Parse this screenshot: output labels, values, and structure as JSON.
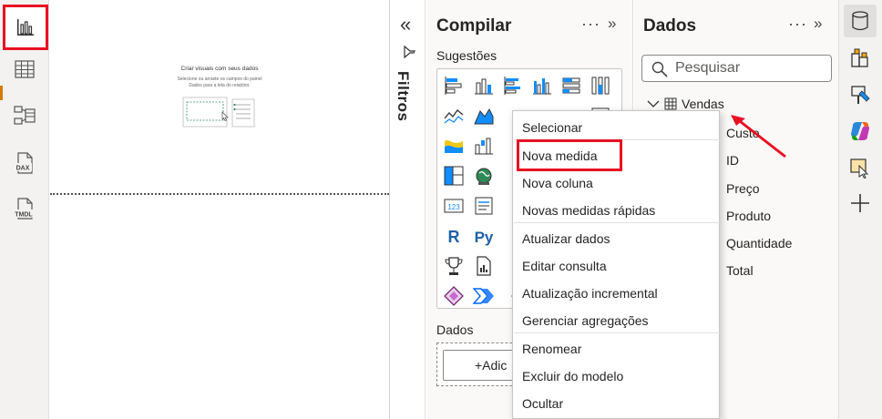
{
  "canvas": {
    "empty_title": "Criar visuais com seus dados",
    "empty_sub_1": "Selecione ou arraste os campos do painel",
    "empty_sub_2": "Dados para a tela do relatório."
  },
  "left_rail": {
    "items": [
      {
        "name": "report-view",
        "icon": "bar-chart-icon"
      },
      {
        "name": "table-view",
        "icon": "table-icon"
      },
      {
        "name": "model-view",
        "icon": "model-icon"
      },
      {
        "name": "dax-view",
        "icon": "dax-icon",
        "label": "DAX"
      },
      {
        "name": "tmdl-view",
        "icon": "tmdl-icon",
        "label": "TMDL"
      }
    ]
  },
  "filters": {
    "title": "Filtros",
    "collapse_glyph": "«"
  },
  "build": {
    "title": "Compilar",
    "more_glyph": "···",
    "expand_glyph": "»",
    "suggestions_label": "Sugestões",
    "data_label": "Dados",
    "add_button": "+Adic"
  },
  "data": {
    "title": "Dados",
    "more_glyph": "···",
    "expand_glyph": "»",
    "search_placeholder": "Pesquisar",
    "table_name": "Vendas",
    "fields": [
      "Custo",
      "ID",
      "Preço",
      "Produto",
      "Quantidade",
      "Total"
    ]
  },
  "context_menu": {
    "items": [
      "Selecionar",
      "Nova medida",
      "Nova coluna",
      "Novas medidas rápidas",
      "Atualizar dados",
      "Editar consulta",
      "Atualização incremental",
      "Gerenciar agregações",
      "Renomear",
      "Excluir do modelo",
      "Ocultar"
    ]
  },
  "colors": {
    "highlight": "#e81123",
    "pane_bg": "#faf9f8",
    "rail_bg": "#f3f2f1"
  }
}
